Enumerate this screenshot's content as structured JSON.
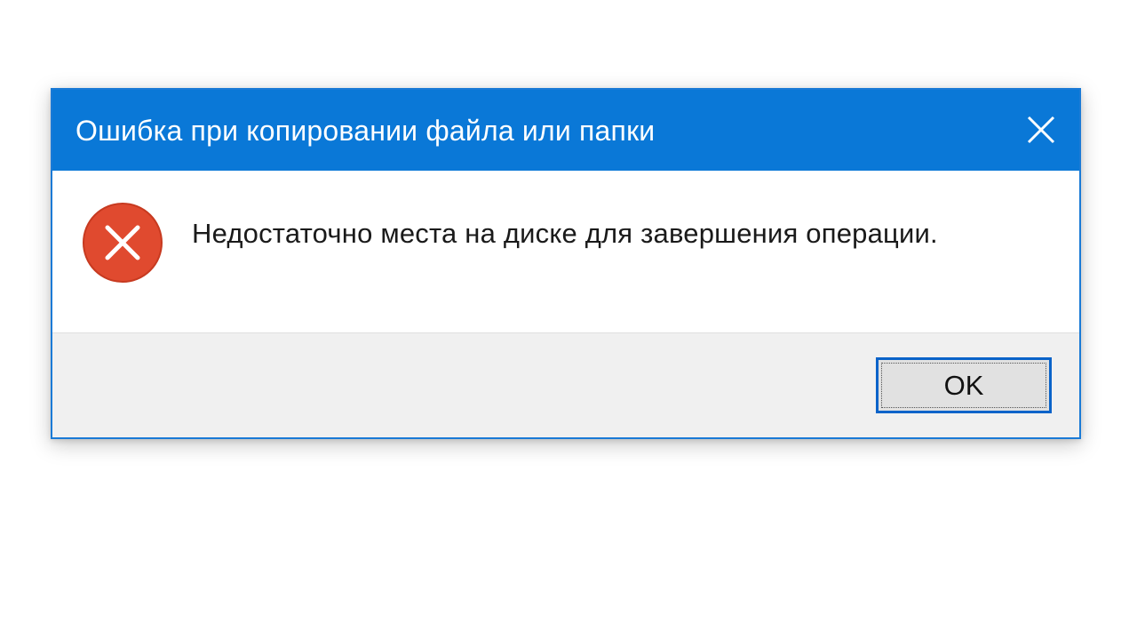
{
  "dialog": {
    "title": "Ошибка при копировании файла или папки",
    "close_icon": "close-icon",
    "message_icon": "error-icon",
    "message": "Недостаточно места на диске для завершения операции.",
    "ok_label": "OK"
  },
  "colors": {
    "titlebar": "#0a78d7",
    "border": "#1a7ad6",
    "footer": "#f0f0f0",
    "button_border": "#0a63c9",
    "error_icon": "#e04a2f"
  }
}
